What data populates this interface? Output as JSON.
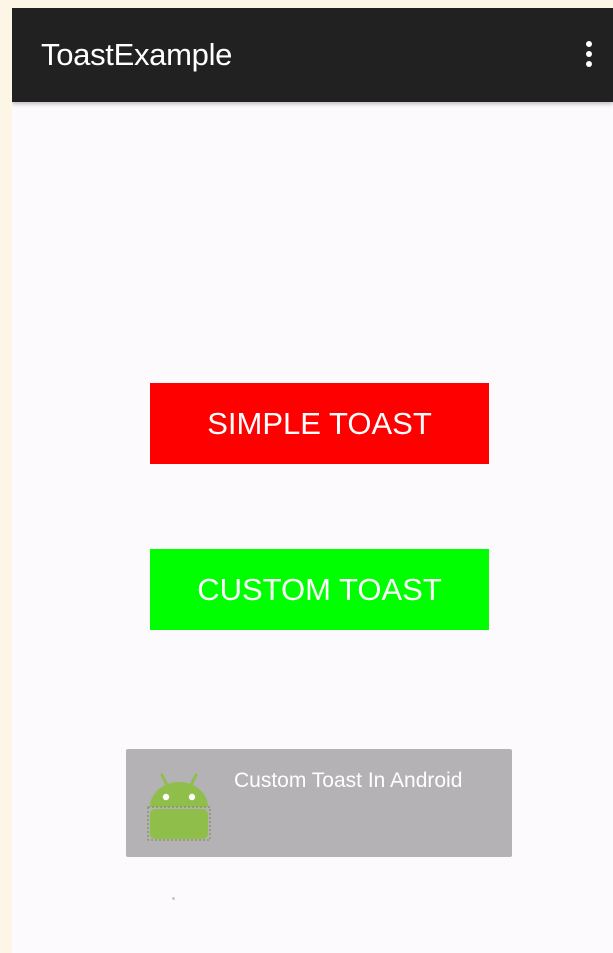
{
  "action_bar": {
    "title": "ToastExample",
    "background": "#212121",
    "overflow_icon": "more-vert-icon"
  },
  "buttons": {
    "simple_toast_label": "SIMPLE TOAST",
    "simple_toast_color": "#ff0000",
    "custom_toast_label": "CUSTOM TOAST",
    "custom_toast_color": "#00ff00"
  },
  "toast": {
    "message": "Custom Toast In Android",
    "icon": "android-robot-icon",
    "background": "#b4b2b5"
  }
}
